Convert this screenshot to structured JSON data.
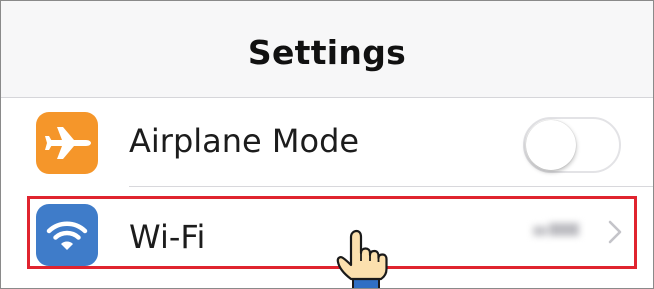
{
  "nav": {
    "title": "Settings"
  },
  "rows": [
    {
      "id": "airplane-mode",
      "label": "Airplane Mode",
      "icon": "airplane-icon",
      "icon_bg": "#f5962a",
      "control": "toggle",
      "toggle_on": false
    },
    {
      "id": "wifi",
      "label": "Wi-Fi",
      "icon": "wifi-icon",
      "icon_bg": "#3f7cc9",
      "value": "",
      "value_blurred": true,
      "control": "chevron",
      "highlighted": true
    }
  ],
  "annotation": {
    "highlight_color": "#e0242f",
    "pointer_icon": "hand-pointer-icon"
  }
}
